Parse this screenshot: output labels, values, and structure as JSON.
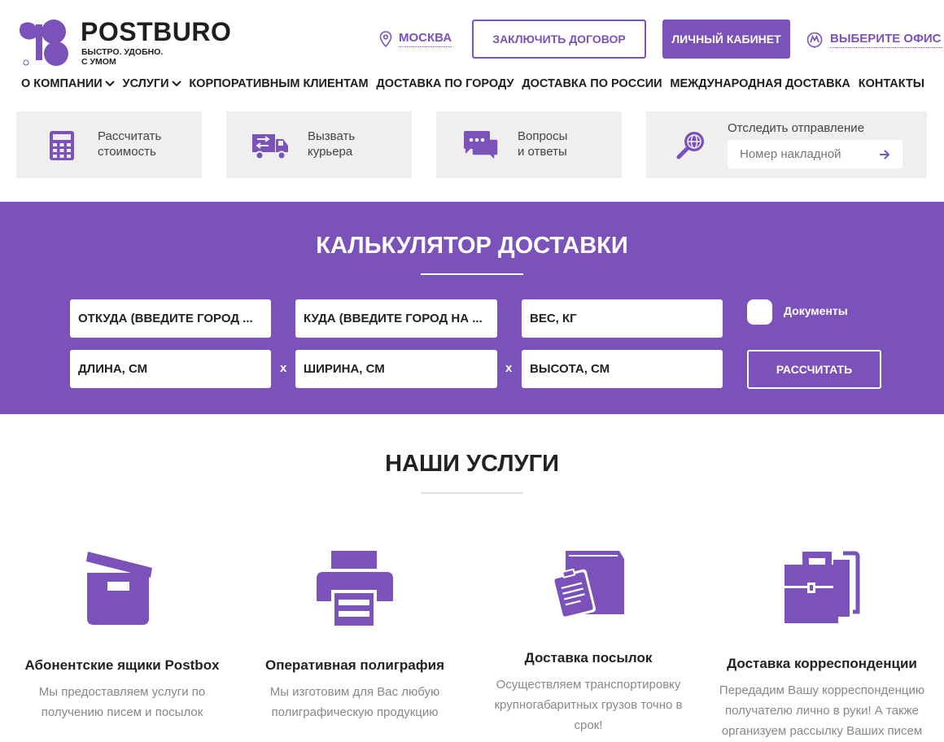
{
  "brand": {
    "name": "POSTBURO",
    "tagline_line1": "БЫСТРО. УДОБНО.",
    "tagline_line2": "С УМОМ",
    "accent": "#7a52b9"
  },
  "header": {
    "city": "МОСКВА",
    "contract_button": "ЗАКЛЮЧИТЬ ДОГОВОР",
    "cabinet_button": "ЛИЧНЫЙ КАБИНЕТ",
    "office_link": "ВЫБЕРИТЕ ОФИС"
  },
  "nav": [
    {
      "label": "О КОМПАНИИ",
      "dropdown": true
    },
    {
      "label": "УСЛУГИ",
      "dropdown": true
    },
    {
      "label": "КОРПОРАТИВНЫМ КЛИЕНТАМ",
      "dropdown": false
    },
    {
      "label": "ДОСТАВКА ПО ГОРОДУ",
      "dropdown": false
    },
    {
      "label": "ДОСТАВКА ПО РОССИИ",
      "dropdown": false
    },
    {
      "label": "МЕЖДУНАРОДНАЯ ДОСТАВКА",
      "dropdown": false
    },
    {
      "label": "КОНТАКТЫ",
      "dropdown": false
    }
  ],
  "tiles": {
    "calculate": {
      "line1": "Рассчитать",
      "line2": "стоимость",
      "icon": "calculator-icon"
    },
    "courier": {
      "line1": "Вызвать",
      "line2": "курьера",
      "icon": "truck-icon"
    },
    "faq": {
      "line1": "Вопросы",
      "line2": "и ответы",
      "icon": "chat-icon"
    },
    "track": {
      "label": "Отследить отправление",
      "placeholder": "Номер накладной",
      "icon": "search-globe-icon"
    }
  },
  "calculator": {
    "title": "КАЛЬКУЛЯТОР ДОСТАВКИ",
    "from": "ОТКУДА (ВВЕДИТЕ ГОРОД ...",
    "to": "КУДА (ВВЕДИТЕ ГОРОД НА ...",
    "weight": "ВЕС, КГ",
    "length": "ДЛИНА, СМ",
    "width": "ШИРИНА, СМ",
    "height": "ВЫСОТА, СМ",
    "times": "x",
    "documents_label": "Документы",
    "submit": "РАССЧИТАТЬ"
  },
  "services": {
    "title": "НАШИ УСЛУГИ",
    "items": [
      {
        "title": "Абонентские ящики Postbox",
        "desc_line1": "Мы предоставляем услуги по",
        "desc_line2": "получению писем и посылок",
        "desc_line3": "",
        "icon": "box-icon"
      },
      {
        "title": "Оперативная полиграфия",
        "desc_line1": "Мы изготовим для Вас любую",
        "desc_line2": "полиграфическую продукцию",
        "desc_line3": "",
        "icon": "printer-icon"
      },
      {
        "title": "Доставка посылок",
        "desc_line1": "Осуществляем транспортировку",
        "desc_line2": "крупногабаритных грузов точно в",
        "desc_line3": "срок!",
        "icon": "parcel-clipboard-icon"
      },
      {
        "title": "Доставка корреспонденции",
        "desc_line1": "Передадим Вашу корреспонденцию",
        "desc_line2": "получателю лично в руки! А также",
        "desc_line3": "организуем рассылку Ваших писем",
        "icon": "briefcase-icon"
      }
    ]
  }
}
